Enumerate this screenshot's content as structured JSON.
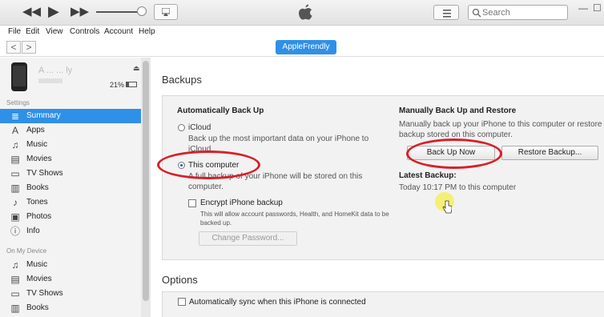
{
  "toolbar": {
    "rewind_icon": "rewind-icon",
    "play_icon": "play-icon",
    "forward_icon": "fast-forward-icon",
    "search_placeholder": "Search"
  },
  "menu": [
    "File",
    "Edit",
    "View",
    "Controls",
    "Account",
    "Help"
  ],
  "nav": {
    "back": "<",
    "forward": ">",
    "device_button": "AppleFrendly"
  },
  "device": {
    "name_partial": "A  ...  ...  ly",
    "battery": "21%",
    "battery_fraction": 0.21
  },
  "sidebar": {
    "settings_header": "Settings",
    "settings_items": [
      {
        "label": "Summary",
        "icon": "≣"
      },
      {
        "label": "Apps",
        "icon": "A"
      },
      {
        "label": "Music",
        "icon": "♫"
      },
      {
        "label": "Movies",
        "icon": "▤"
      },
      {
        "label": "TV Shows",
        "icon": "▭"
      },
      {
        "label": "Books",
        "icon": "▥"
      },
      {
        "label": "Tones",
        "icon": "♪"
      },
      {
        "label": "Photos",
        "icon": "▣"
      },
      {
        "label": "Info",
        "icon": "ⓘ"
      }
    ],
    "device_header": "On My Device",
    "device_items": [
      {
        "label": "Music",
        "icon": "♫"
      },
      {
        "label": "Movies",
        "icon": "▤"
      },
      {
        "label": "TV Shows",
        "icon": "▭"
      },
      {
        "label": "Books",
        "icon": "▥"
      }
    ]
  },
  "backups": {
    "heading": "Backups",
    "auto_title": "Automatically Back Up",
    "icloud_label": "iCloud",
    "icloud_desc": "Back up the most important data on your iPhone to iCloud.",
    "computer_label": "This computer",
    "computer_desc": "A full backup of your iPhone will be stored on this computer.",
    "encrypt_label": "Encrypt iPhone backup",
    "encrypt_desc": "This will allow account passwords, Health, and HomeKit data to be backed up.",
    "change_password": "Change Password...",
    "manual_title": "Manually Back Up and Restore",
    "manual_desc": "Manually back up your iPhone to this computer or restore a backup stored on this computer.",
    "backup_now": "Back Up Now",
    "restore": "Restore Backup...",
    "latest_title": "Latest Backup:",
    "latest_value": "Today 10:17 PM to this computer"
  },
  "options": {
    "heading": "Options",
    "autosync_label": "Automatically sync when this iPhone is connected"
  },
  "colors": {
    "accent": "#2f90e8",
    "annotation": "#d81f2a"
  }
}
